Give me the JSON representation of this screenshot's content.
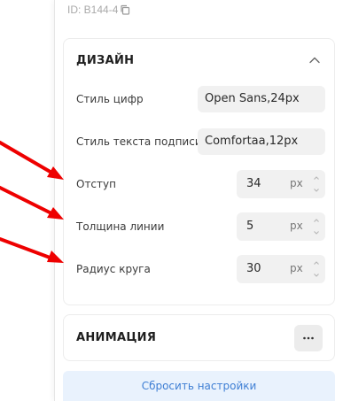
{
  "header": {
    "id_text": "ID: B144-4"
  },
  "design": {
    "title": "ДИЗАЙН",
    "digit_style": {
      "label": "Стиль цифр",
      "value": "Open Sans,24px"
    },
    "caption_style": {
      "label": "Стиль текста подписи",
      "value": "Comfortaa,12px"
    },
    "padding": {
      "label": "Отступ",
      "value": "34",
      "unit": "px"
    },
    "line_width": {
      "label": "Толщина линии",
      "value": "5",
      "unit": "px"
    },
    "circle_radius": {
      "label": "Радиус круга",
      "value": "30",
      "unit": "px"
    }
  },
  "animation": {
    "title": "АНИМАЦИЯ",
    "more_label": "···"
  },
  "footer": {
    "reset_label": "Сбросить настройки"
  },
  "colors": {
    "accent": "#3f7fd4",
    "arrow": "#ee0000"
  }
}
